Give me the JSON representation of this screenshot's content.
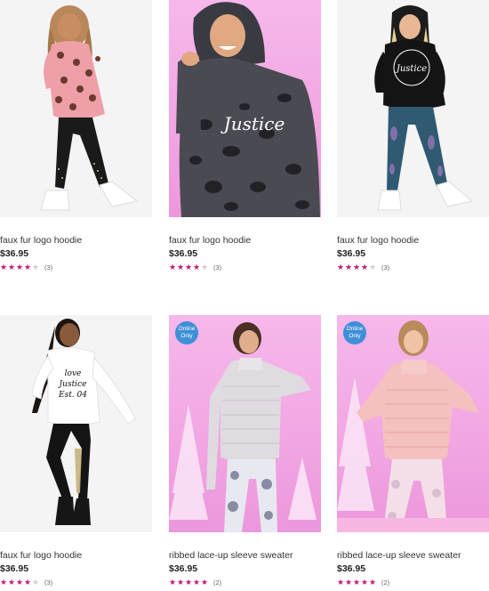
{
  "products": [
    {
      "name": "faux fur logo hoodie",
      "price": "$36.95",
      "rating": 4,
      "review_count": "(3)",
      "online_only": false,
      "background": "white",
      "photo": "girl-leopard-hoodie",
      "print": ""
    },
    {
      "name": "faux fur logo hoodie",
      "price": "$36.95",
      "rating": 4,
      "review_count": "(3)",
      "online_only": false,
      "background": "pink",
      "photo": "girl-black-leopard-hoodie",
      "print": "Justice"
    },
    {
      "name": "faux fur logo hoodie",
      "price": "$36.95",
      "rating": 4,
      "review_count": "(3)",
      "online_only": false,
      "background": "white",
      "photo": "girl-black-hoodie",
      "print": "Justice"
    },
    {
      "name": "faux fur logo hoodie",
      "price": "$36.95",
      "rating": 4,
      "review_count": "(3)",
      "online_only": false,
      "background": "white",
      "photo": "girl-white-hoodie",
      "print": "love Justice Est. 04"
    },
    {
      "name": "ribbed lace-up sleeve sweater",
      "price": "$36.95",
      "rating": 5,
      "review_count": "(2)",
      "online_only": true,
      "background": "pink",
      "photo": "girl-grey-sweater",
      "print": ""
    },
    {
      "name": "ribbed lace-up sleeve sweater",
      "price": "$36.95",
      "rating": 5,
      "review_count": "(2)",
      "online_only": true,
      "background": "pink",
      "photo": "girl-pink-sweater",
      "print": ""
    }
  ],
  "badge": {
    "line1": "Online",
    "line2": "Only"
  },
  "colors": {
    "star_on": "#c8187a",
    "star_off": "#cfcfcf",
    "badge": "#3f8fd8",
    "pink_bg": "#f2a7e3"
  }
}
